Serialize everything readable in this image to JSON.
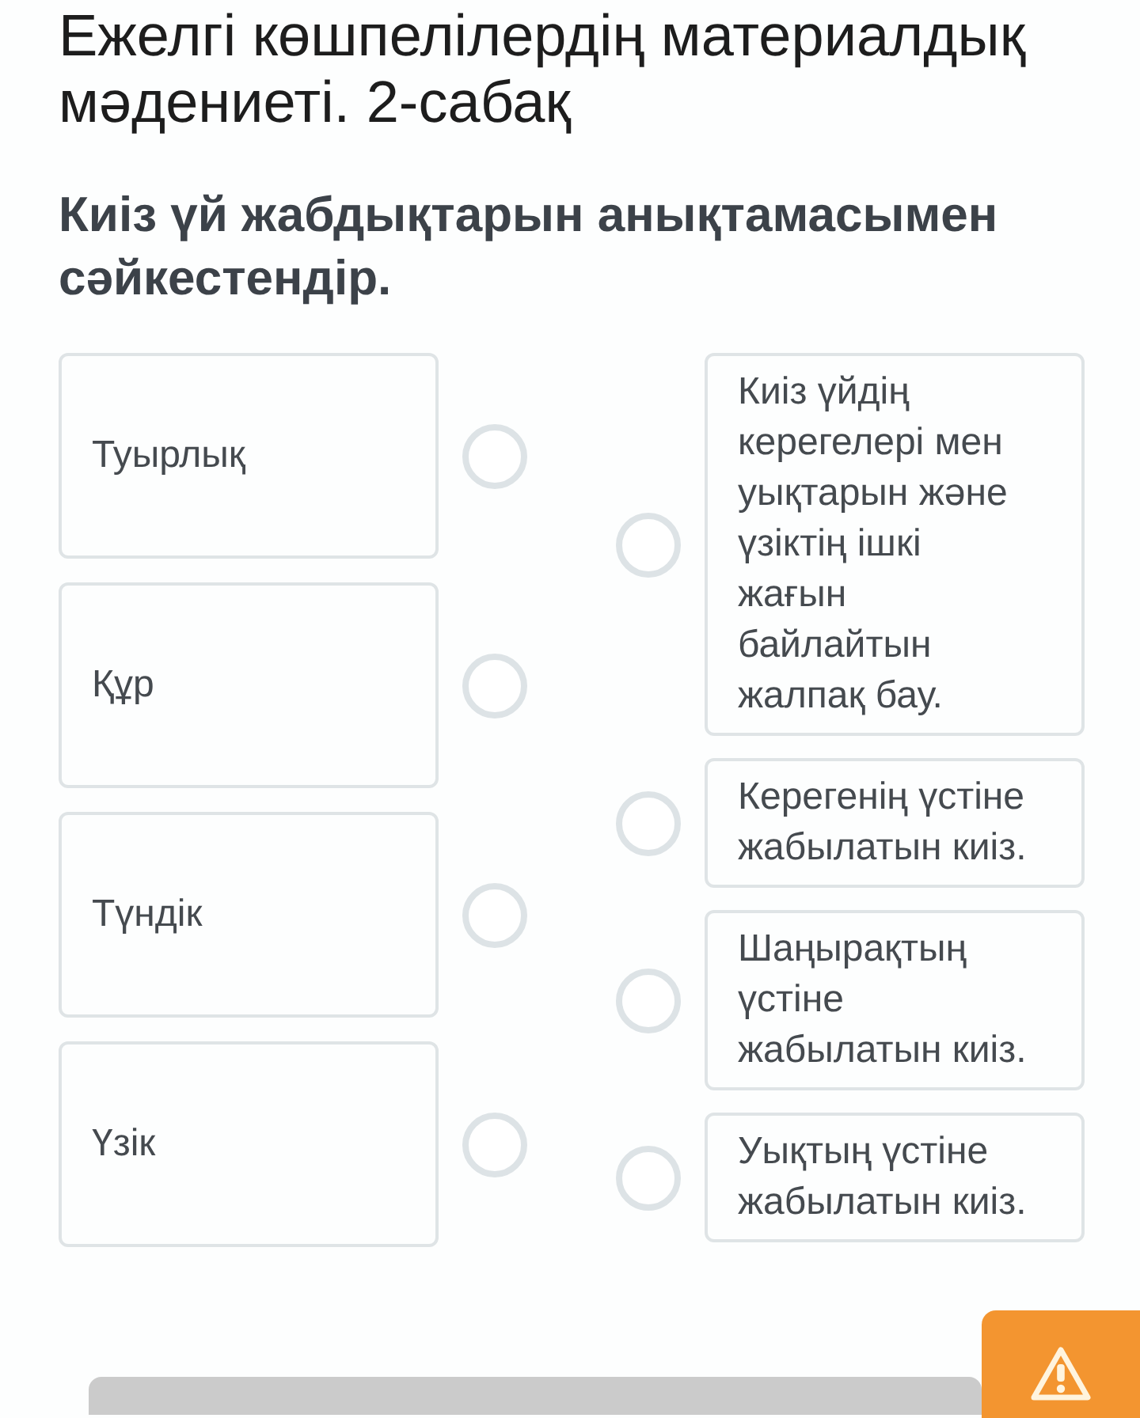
{
  "lesson_title": "Ежелгі көшпелілердің материалдық мәдениеті. 2-сабақ",
  "question": "Киіз үй жабдықтарын анықтамасымен сәйкестендір.",
  "terms": [
    {
      "text": "Туырлық",
      "selected": false
    },
    {
      "text": "Құр",
      "selected": false
    },
    {
      "text": "Түндік",
      "selected": false
    },
    {
      "text": "Үзік",
      "selected": false
    }
  ],
  "definitions": [
    {
      "text": "Киіз үйдің керегелері мен уықтарын және үзіктің ішкі жағын байлайтын жалпақ бау.",
      "selected": false
    },
    {
      "text": "Керегенің үстіне жабылатын киіз.",
      "selected": false
    },
    {
      "text": "Шаңырақтың үстіне жабылатын киіз.",
      "selected": false
    },
    {
      "text": "Уықтың үстіне жабылатын киіз.",
      "selected": false
    }
  ]
}
